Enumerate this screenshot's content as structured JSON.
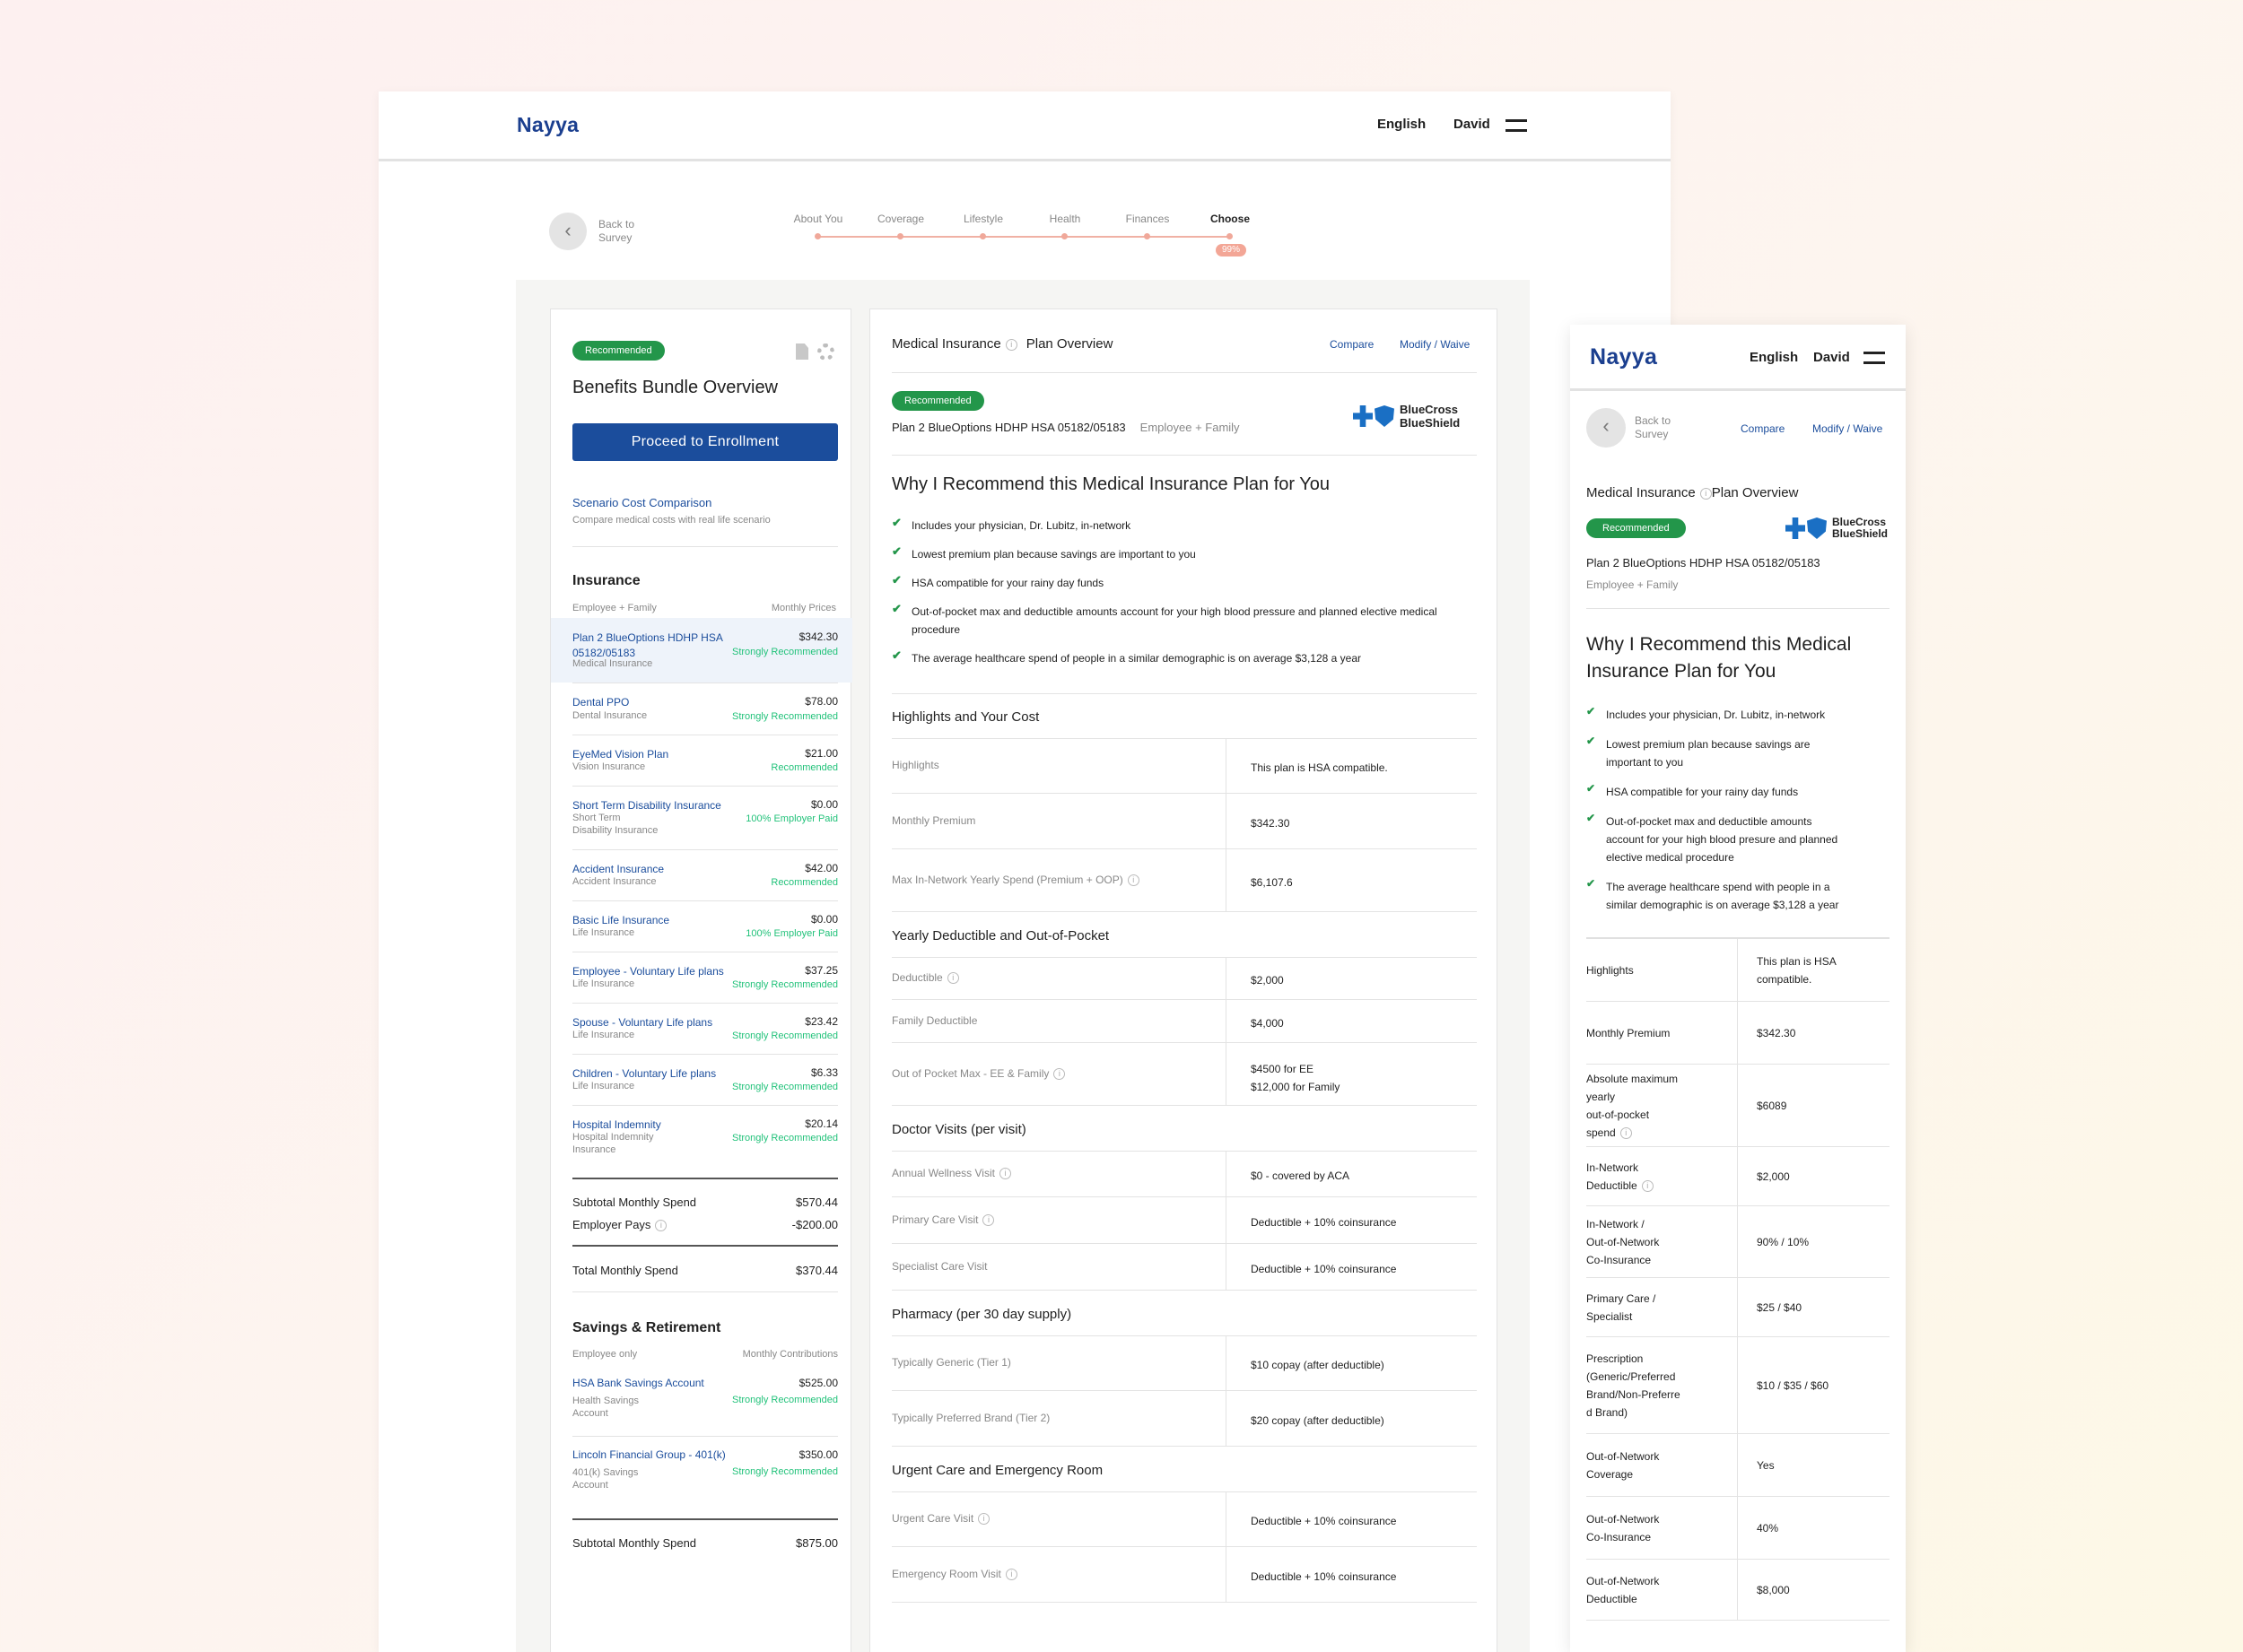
{
  "header": {
    "logo": "Nayya",
    "language": "English",
    "user": "David"
  },
  "nav": {
    "back_line1": "Back to",
    "back_line2": "Survey"
  },
  "steps": [
    "About You",
    "Coverage",
    "Lifestyle",
    "Health",
    "Finances",
    "Choose"
  ],
  "progress": {
    "label": "99%",
    "value": 0.99
  },
  "bundle": {
    "badge": "Recommended",
    "title": "Benefits Bundle Overview",
    "cta": "Proceed to Enrollment",
    "scenario_link": "Scenario Cost Comparison",
    "scenario_desc": "Compare medical costs with real life scenario",
    "insurance_title": "Insurance",
    "insurance_sub_left": "Employee + Family",
    "insurance_sub_right": "Monthly Prices",
    "items": [
      {
        "name": "Plan 2 BlueOptions HDHP HSA 05182/05183",
        "type": "Medical Insurance",
        "price": "$342.30",
        "tag": "Strongly Recommended"
      },
      {
        "name": "Dental PPO",
        "type": "Dental Insurance",
        "price": "$78.00",
        "tag": "Strongly Recommended"
      },
      {
        "name": "EyeMed Vision Plan",
        "type": "Vision Insurance",
        "price": "$21.00",
        "tag": "Recommended"
      },
      {
        "name": "Short Term Disability Insurance",
        "type": "Short Term Disability Insurance",
        "price": "$0.00",
        "tag": "100% Employer Paid"
      },
      {
        "name": "Accident Insurance",
        "type": "Accident Insurance",
        "price": "$42.00",
        "tag": "Recommended"
      },
      {
        "name": "Basic Life Insurance",
        "type": "Life Insurance",
        "price": "$0.00",
        "tag": "100% Employer Paid"
      },
      {
        "name": "Employee - Voluntary Life plans",
        "type": "Life Insurance",
        "price": "$37.25",
        "tag": "Strongly Recommended"
      },
      {
        "name": "Spouse - Voluntary Life plans",
        "type": "Life Insurance",
        "price": "$23.42",
        "tag": "Strongly Recommended"
      },
      {
        "name": "Children - Voluntary Life plans",
        "type": "Life Insurance",
        "price": "$6.33",
        "tag": "Strongly Recommended"
      },
      {
        "name": "Hospital Indemnity",
        "type": "Hospital Indemnity Insurance",
        "price": "$20.14",
        "tag": "Strongly Recommended"
      }
    ],
    "subtotal_label": "Subtotal Monthly Spend",
    "subtotal": "$570.44",
    "employer_label": "Employer Pays",
    "employer": "-$200.00",
    "total_label": "Total Monthly Spend",
    "total": "$370.44",
    "savings_title": "Savings & Retirement",
    "savings_sub_left": "Employee only",
    "savings_sub_right": "Monthly Contributions",
    "savings": [
      {
        "name": "HSA Bank Savings Account",
        "type": "Health Savings Account",
        "price": "$525.00",
        "tag": "Strongly Recommended"
      },
      {
        "name": "Lincoln Financial Group - 401(k)",
        "type": "401(k) Savings Account",
        "price": "$350.00",
        "tag": "Strongly Recommended"
      }
    ],
    "savings_subtotal_label": "Subtotal Monthly Spend",
    "savings_subtotal": "$875.00"
  },
  "plan": {
    "section": "Medical Insurance",
    "overview": "Plan Overview",
    "compare": "Compare",
    "modify": "Modify / Waive",
    "badge": "Recommended",
    "name": "Plan 2 BlueOptions HDHP HSA 05182/05183",
    "coverage": "Employee + Family",
    "carrier_line1": "BlueCross",
    "carrier_line2": "BlueShield",
    "why_title": "Why I Recommend this Medical Insurance Plan for You",
    "reasons": [
      "Includes your physician, Dr. Lubitz, in-network",
      "Lowest premium plan because savings are important to you",
      "HSA compatible for your rainy day funds",
      "Out-of-pocket max and deductible amounts account for your high blood pressure and planned elective medical procedure",
      "The average healthcare spend of people in a similar demographic is on average $3,128 a year"
    ],
    "sections": [
      {
        "title": "Highlights and Your Cost",
        "rows": [
          [
            "Highlights",
            "This plan is HSA compatible."
          ],
          [
            "Monthly Premium",
            "$342.30"
          ],
          [
            "Max In-Network Yearly Spend (Premium + OOP)",
            "$6,107.6"
          ]
        ]
      },
      {
        "title": "Yearly Deductible and Out-of-Pocket",
        "rows": [
          [
            "Deductible",
            "$2,000"
          ],
          [
            "Family Deductible",
            "$4,000"
          ],
          [
            "Out of Pocket Max - EE & Family",
            "$4500 for EE",
            "$12,000 for Family"
          ]
        ]
      },
      {
        "title": "Doctor Visits (per visit)",
        "rows": [
          [
            "Annual Wellness Visit",
            "$0 - covered by ACA"
          ],
          [
            "Primary Care Visit",
            "Deductible + 10% coinsurance"
          ],
          [
            "Specialist Care Visit",
            "Deductible + 10% coinsurance"
          ]
        ]
      },
      {
        "title": "Pharmacy (per 30 day supply)",
        "rows": [
          [
            "Typically Generic (Tier 1)",
            "$10 copay (after deductible)"
          ],
          [
            "Typically Preferred Brand (Tier 2)",
            "$20 copay (after deductible)"
          ]
        ]
      },
      {
        "title": "Urgent Care and Emergency Room",
        "rows": [
          [
            "Urgent Care Visit",
            "Deductible + 10% coinsurance"
          ],
          [
            "Emergency Room Visit",
            "Deductible + 10% coinsurance"
          ]
        ]
      }
    ]
  },
  "mobile": {
    "logo": "Nayya",
    "language": "English",
    "user": "David",
    "back_line1": "Back to",
    "back_line2": "Survey",
    "compare": "Compare",
    "modify": "Modify / Waive",
    "section": "Medical Insurance",
    "overview": "Plan Overview",
    "badge": "Recommended",
    "name": "Plan 2 BlueOptions HDHP HSA 05182/05183",
    "coverage": "Employee + Family",
    "carrier_line1": "BlueCross",
    "carrier_line2": "BlueShield",
    "why_line1": "Why I Recommend this Medical",
    "why_line2": "Insurance Plan for You",
    "reasons": [
      [
        "Includes your physician, Dr. Lubitz, in-network"
      ],
      [
        "Lowest premium plan because savings are",
        "important to you"
      ],
      [
        "HSA compatible for your rainy day funds"
      ],
      [
        "Out-of-pocket max and deductible amounts",
        "account for your high blood presure and planned",
        "elective medical procedure"
      ],
      [
        "The average healthcare spend with people in a",
        "similar demographic is on average $3,128 a year"
      ]
    ],
    "rows": [
      {
        "label": [
          "Highlights"
        ],
        "value": [
          "This plan is HSA",
          "compatible."
        ]
      },
      {
        "label": [
          "Monthly Premium"
        ],
        "value": [
          "$342.30"
        ]
      },
      {
        "label": [
          "Absolute maximum",
          "yearly",
          "out-of-pocket",
          "spend"
        ],
        "value": [
          "$6089"
        ]
      },
      {
        "label": [
          "In-Network",
          "Deductible"
        ],
        "value": [
          "$2,000"
        ]
      },
      {
        "label": [
          "In-Network /",
          "Out-of-Network",
          "Co-Insurance"
        ],
        "value": [
          "90% / 10%"
        ]
      },
      {
        "label": [
          "Primary Care /",
          "Specialist"
        ],
        "value": [
          "$25 / $40"
        ]
      },
      {
        "label": [
          "Prescription",
          "(Generic/Preferred",
          "Brand/Non-Preferre",
          "d Brand)"
        ],
        "value": [
          "$10 / $35 / $60"
        ]
      },
      {
        "label": [
          "Out-of-Network",
          "Coverage"
        ],
        "value": [
          "Yes"
        ]
      },
      {
        "label": [
          "Out-of-Network",
          "Co-Insurance"
        ],
        "value": [
          "40%"
        ]
      },
      {
        "label": [
          "Out-of-Network",
          "Deductible"
        ],
        "value": [
          "$8,000"
        ]
      }
    ]
  }
}
